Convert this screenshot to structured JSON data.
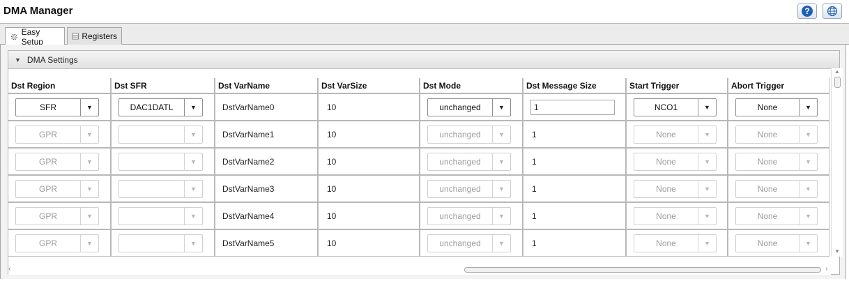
{
  "window": {
    "title": "DMA Manager"
  },
  "header_buttons": {
    "help_label": "?",
    "help_icon": "help-icon",
    "globe_icon": "globe-icon"
  },
  "tabs": [
    {
      "label": "Easy Setup",
      "icon": "gear-icon",
      "active": true
    },
    {
      "label": "Registers",
      "icon": "registers-icon",
      "active": false
    }
  ],
  "section": {
    "title": "DMA Settings"
  },
  "columns": [
    "Dst Region",
    "Dst SFR",
    "Dst VarName",
    "Dst VarSize",
    "Dst Mode",
    "Dst Message Size",
    "Start Trigger",
    "Abort Trigger"
  ],
  "rows": [
    {
      "region": "SFR",
      "sfr": "DAC1DATL",
      "varname": "DstVarName0",
      "varsize": "10",
      "mode": "unchanged",
      "msgsize": "1",
      "start": "NCO1",
      "abort": "None",
      "enabled": true
    },
    {
      "region": "GPR",
      "sfr": "",
      "varname": "DstVarName1",
      "varsize": "10",
      "mode": "unchanged",
      "msgsize": "1",
      "start": "None",
      "abort": "None",
      "enabled": false
    },
    {
      "region": "GPR",
      "sfr": "",
      "varname": "DstVarName2",
      "varsize": "10",
      "mode": "unchanged",
      "msgsize": "1",
      "start": "None",
      "abort": "None",
      "enabled": false
    },
    {
      "region": "GPR",
      "sfr": "",
      "varname": "DstVarName3",
      "varsize": "10",
      "mode": "unchanged",
      "msgsize": "1",
      "start": "None",
      "abort": "None",
      "enabled": false
    },
    {
      "region": "GPR",
      "sfr": "",
      "varname": "DstVarName4",
      "varsize": "10",
      "mode": "unchanged",
      "msgsize": "1",
      "start": "None",
      "abort": "None",
      "enabled": false
    },
    {
      "region": "GPR",
      "sfr": "",
      "varname": "DstVarName5",
      "varsize": "10",
      "mode": "unchanged",
      "msgsize": "1",
      "start": "None",
      "abort": "None",
      "enabled": false
    }
  ]
}
